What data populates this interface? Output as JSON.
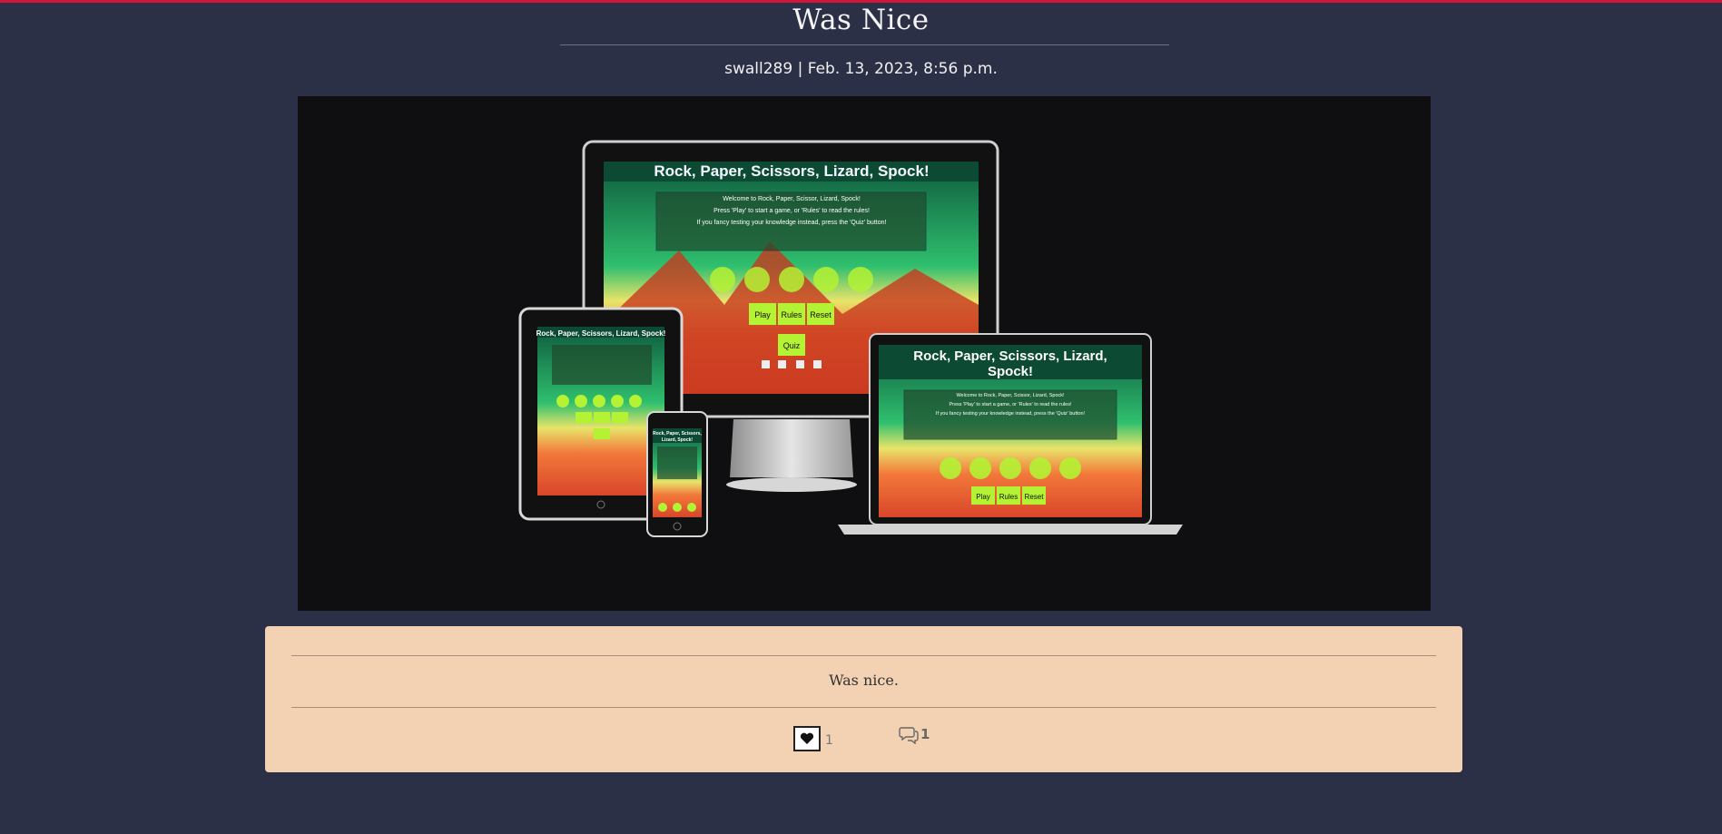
{
  "post": {
    "title": "Was Nice",
    "meta": "swall289 | Feb. 13, 2023, 8:56 p.m.",
    "body": "Was nice.",
    "likes": "1",
    "comments": "1"
  },
  "mockup": {
    "app_title": "Rock, Paper, Scissors, Lizard, Spock!",
    "app_title_laptop_line1": "Rock, Paper, Scissors, Lizard,",
    "app_title_laptop_line2": "Spock!",
    "tablet_title": "Rock, Paper, Scissors, Lizard, Spock!",
    "phone_title_line1": "Rock, Paper, Scissors,",
    "phone_title_line2": "Lizard, Spock!",
    "welcome_line1": "Welcome to Rock, Paper, Scissor, Lizard, Spock!",
    "welcome_line2": "Press 'Play' to start a game, or 'Rules' to read the rules!",
    "welcome_line3": "If you fancy testing your knowledge instead, press the 'Quiz' button!",
    "play_label": "Play",
    "rules_label": "Rules",
    "reset_label": "Reset",
    "quiz_label": "Quiz"
  },
  "icons": {
    "like": "heart-icon",
    "comments": "comment-icon"
  },
  "colors": {
    "accent_bar": "#d1163a",
    "page_background": "#2c3047",
    "card_background": "#f2d2b2",
    "button_green": "#b4f234"
  }
}
